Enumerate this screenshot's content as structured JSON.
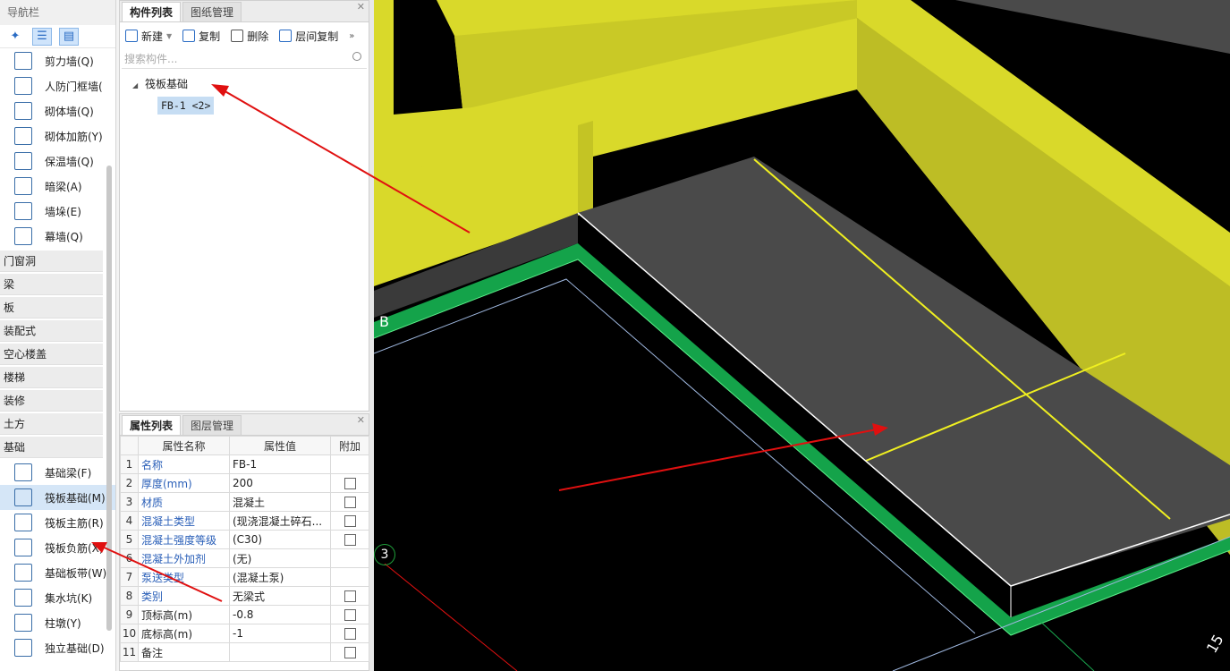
{
  "nav": {
    "title": "导航栏",
    "close": "×",
    "items_top": [
      {
        "label": "剪力墙(Q)",
        "icon": "shear-wall-icon"
      },
      {
        "label": "人防门框墙(",
        "icon": "civil-defense-door-wall-icon"
      },
      {
        "label": "砌体墙(Q)",
        "icon": "masonry-wall-icon"
      },
      {
        "label": "砌体加筋(Y)",
        "icon": "masonry-reinforcement-icon"
      },
      {
        "label": "保温墙(Q)",
        "icon": "insulation-wall-icon"
      },
      {
        "label": "暗梁(A)",
        "icon": "hidden-beam-icon"
      },
      {
        "label": "墙垛(E)",
        "icon": "wall-pier-icon"
      },
      {
        "label": "幕墙(Q)",
        "icon": "curtain-wall-icon"
      }
    ],
    "categories": [
      "门窗洞",
      "梁",
      "板",
      "装配式",
      "空心楼盖",
      "楼梯",
      "装修",
      "土方",
      "基础"
    ],
    "items_bottom": [
      {
        "label": "基础梁(F)",
        "icon": "foundation-beam-icon"
      },
      {
        "label": "筏板基础(M)",
        "icon": "raft-foundation-icon"
      },
      {
        "label": "筏板主筋(R)",
        "icon": "raft-main-rebar-icon"
      },
      {
        "label": "筏板负筋(X)",
        "icon": "raft-negative-rebar-icon"
      },
      {
        "label": "基础板带(W)",
        "icon": "foundation-strip-icon"
      },
      {
        "label": "集水坑(K)",
        "icon": "sump-pit-icon"
      },
      {
        "label": "柱墩(Y)",
        "icon": "column-pier-icon"
      },
      {
        "label": "独立基础(D)",
        "icon": "isolated-footing-icon"
      }
    ]
  },
  "component_panel": {
    "tabs": [
      "构件列表",
      "图纸管理"
    ],
    "toolbar": {
      "new": "新建",
      "copy": "复制",
      "delete": "删除",
      "floor_copy": "层间复制",
      "more": "»"
    },
    "search_placeholder": "搜索构件...",
    "tree": {
      "group": "筏板基础",
      "item": "FB-1 <2>"
    }
  },
  "property_panel": {
    "tabs": [
      "属性列表",
      "图层管理"
    ],
    "headers": [
      "属性名称",
      "属性值",
      "附加"
    ],
    "rows": [
      {
        "n": "1",
        "name": "名称",
        "value": "FB-1",
        "blue": true,
        "check": false
      },
      {
        "n": "2",
        "name": "厚度(mm)",
        "value": "200",
        "blue": true,
        "check": true
      },
      {
        "n": "3",
        "name": "材质",
        "value": "混凝土",
        "blue": true,
        "check": true
      },
      {
        "n": "4",
        "name": "混凝土类型",
        "value": "(现浇混凝土碎石...",
        "blue": true,
        "check": true
      },
      {
        "n": "5",
        "name": "混凝土强度等级",
        "value": "(C30)",
        "blue": true,
        "check": true
      },
      {
        "n": "6",
        "name": "混凝土外加剂",
        "value": "(无)",
        "blue": true,
        "check": false
      },
      {
        "n": "7",
        "name": "泵送类型",
        "value": "(混凝土泵)",
        "blue": true,
        "check": false
      },
      {
        "n": "8",
        "name": "类别",
        "value": "无梁式",
        "blue": true,
        "check": true
      },
      {
        "n": "9",
        "name": "顶标高(m)",
        "value": "-0.8",
        "blue": false,
        "check": true
      },
      {
        "n": "10",
        "name": "底标高(m)",
        "value": "-1",
        "blue": false,
        "check": true
      },
      {
        "n": "11",
        "name": "备注",
        "value": "",
        "blue": false,
        "check": true
      }
    ]
  },
  "viewport": {
    "axis_label_left": "B",
    "axis_circle": "3",
    "axis_label_bottom": "15",
    "colors": {
      "wall_yellow": "#d9d92a",
      "wall_dark": "#b5b523",
      "slab": "#4a4a4a",
      "edge_green": "#1aa84f",
      "arrow": "#e01010"
    }
  }
}
